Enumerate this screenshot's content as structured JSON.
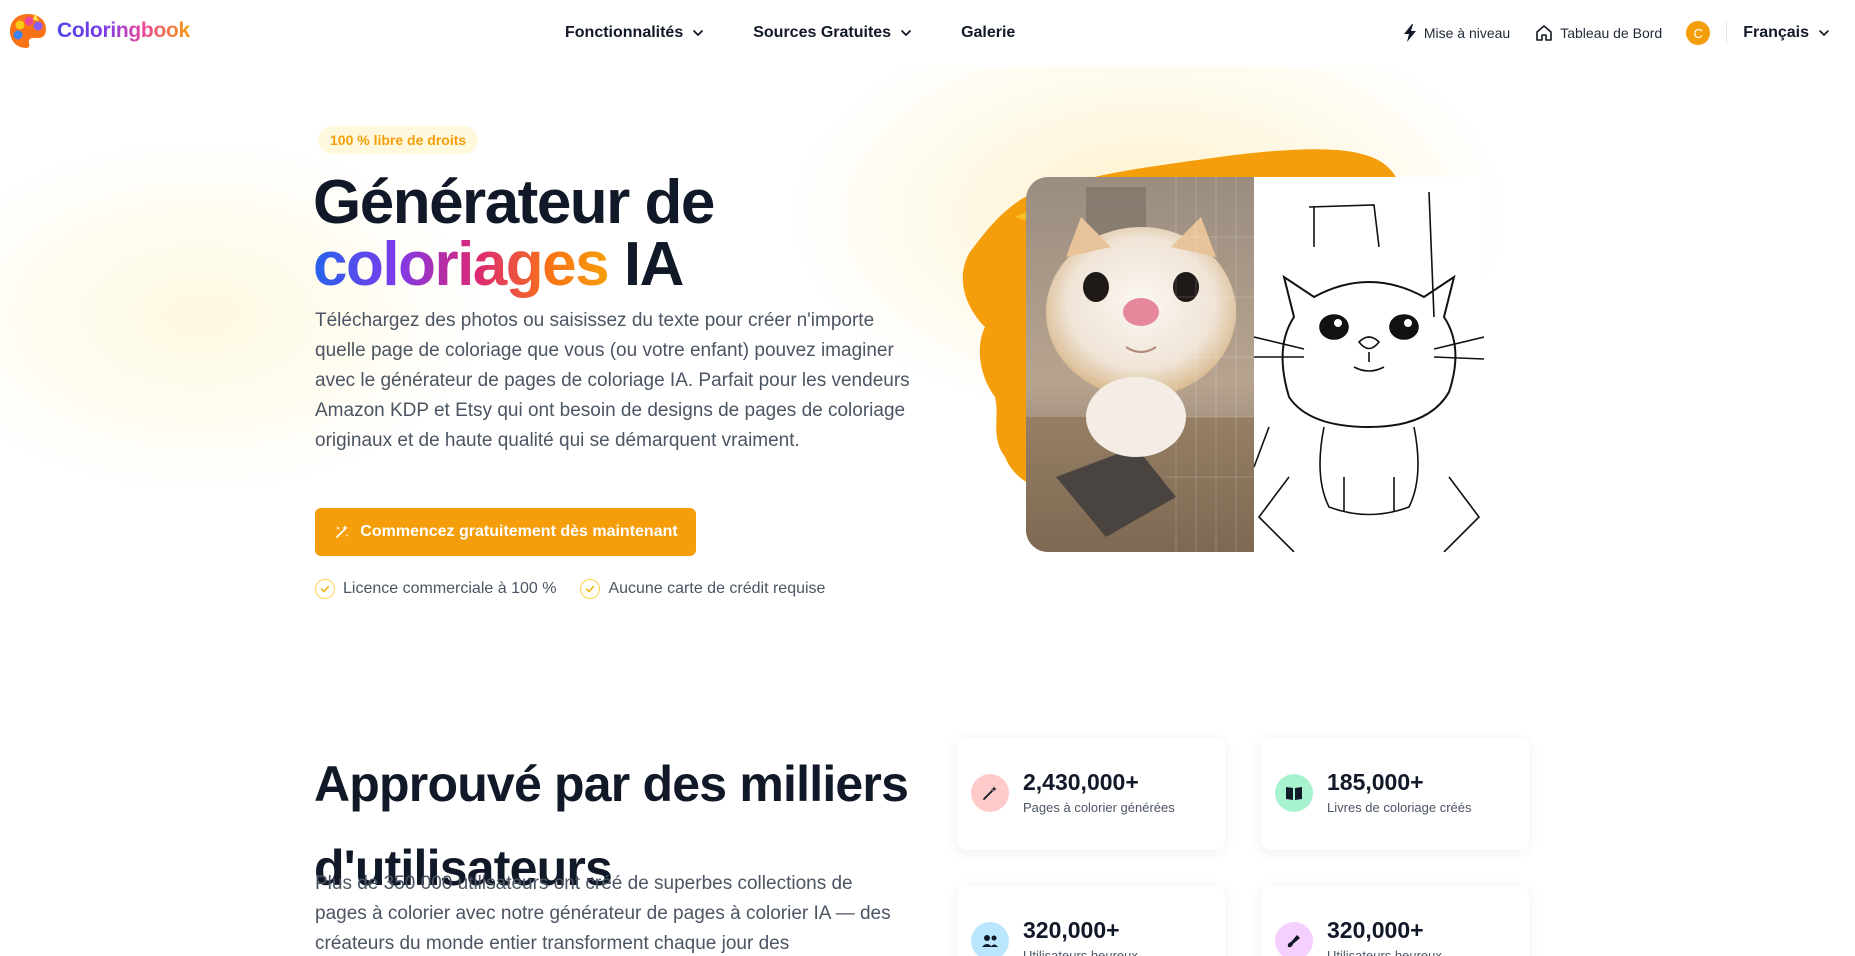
{
  "header": {
    "brand": "Coloringbook",
    "nav": [
      {
        "label": "Fonctionnalités"
      },
      {
        "label": "Sources Gratuites"
      },
      {
        "label": "Galerie"
      }
    ],
    "upgrade_label": "Mise à niveau",
    "dashboard_label": "Tableau de Bord",
    "avatar_initial": "C",
    "language": "Français"
  },
  "hero": {
    "badge": "100 % libre de droits",
    "title_line1": "Générateur de",
    "title_grad": "coloriages",
    "title_tail": " IA",
    "lead": "Téléchargez des photos ou saisissez du texte pour créer n'importe quelle page de coloriage que vous (ou votre enfant) pouvez imaginer avec le générateur de pages de coloriage IA. Parfait pour les vendeurs Amazon KDP et Etsy qui ont besoin de designs de pages de coloriage originaux et de haute qualité qui se démarquent vraiment.",
    "cta": "Commencez gratuitement dès maintenant",
    "checks": [
      "Licence commerciale à 100 %",
      "Aucune carte de crédit requise"
    ]
  },
  "trust": {
    "title_line1": "Approuvé par des milliers",
    "title_line2": "d'utilisateurs",
    "subtitle": "Plus de 350 000 utilisateurs ont créé de superbes collections de pages à colorier avec notre générateur de pages à colorier IA — des créateurs du monde entier transforment chaque jour des",
    "stats": [
      {
        "value": "2,430,000+",
        "label": "Pages à colorier générées",
        "icon": "magic-wand-icon",
        "color": "#fecaca"
      },
      {
        "value": "185,000+",
        "label": "Livres de coloriage créés",
        "icon": "book-icon",
        "color": "#a7f3d0"
      },
      {
        "value": "320,000+",
        "label": "Utilisateurs heureux",
        "icon": "users-icon",
        "color": "#bae6fd"
      },
      {
        "value": "320,000+",
        "label": "Utilisateurs heureux",
        "icon": "brush-icon",
        "color": "#f5d0fe"
      }
    ]
  },
  "colors": {
    "accent": "#f59e0b",
    "text": "#111827",
    "muted": "#4b5563"
  }
}
